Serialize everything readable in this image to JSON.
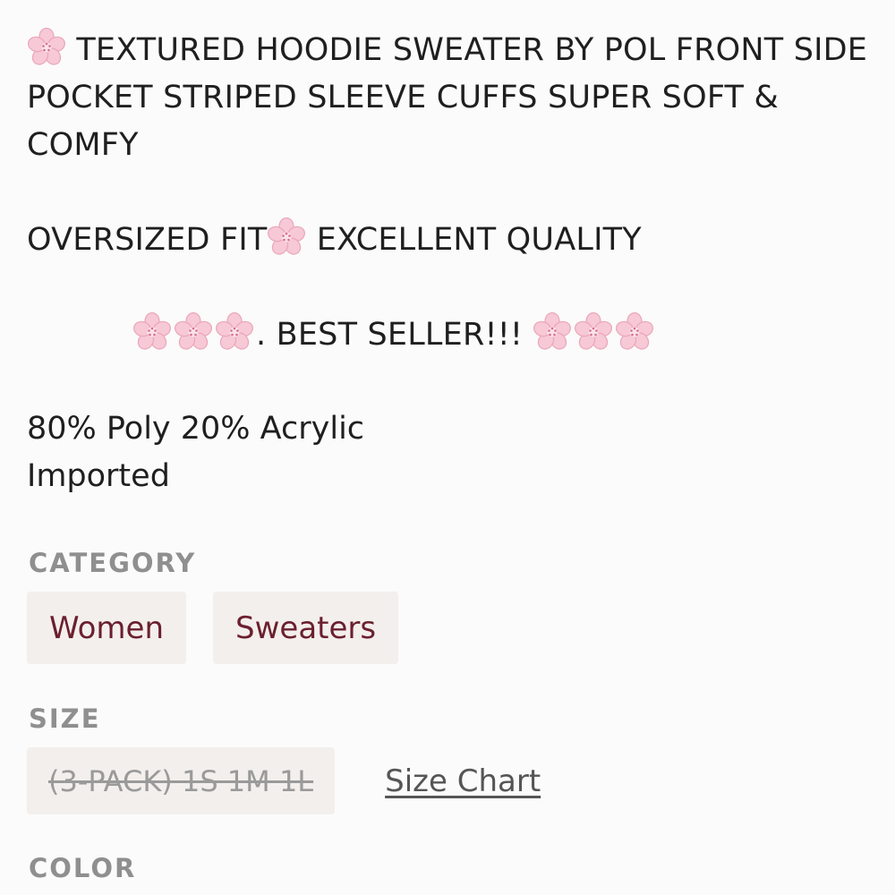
{
  "description": {
    "line1": "TEXTURED HOODIE SWEATER BY POL FRONT SIDE POCKET STRIPED SLEEVE CUFFS SUPER SOFT & COMFY",
    "line2_a": "OVERSIZED FIT",
    "line2_b": "EXCELLENT QUALITY",
    "best_seller": ". BEST SELLER!!!",
    "emoji": "cherry-blossom-icon"
  },
  "fabric": {
    "composition": "80% Poly 20% Acrylic",
    "origin": "Imported"
  },
  "category": {
    "title": "CATEGORY",
    "items": [
      "Women",
      "Sweaters"
    ]
  },
  "size": {
    "title": "SIZE",
    "option": "(3-PACK) 1S 1M 1L",
    "size_chart_link": "Size Chart"
  },
  "color": {
    "title": "COLOR"
  },
  "colors": {
    "chip_bg": "#f3efec",
    "chip_text": "#6b1f2e",
    "label_gray": "#8f8f8f",
    "blossom_pink": "#f6c6d4"
  }
}
